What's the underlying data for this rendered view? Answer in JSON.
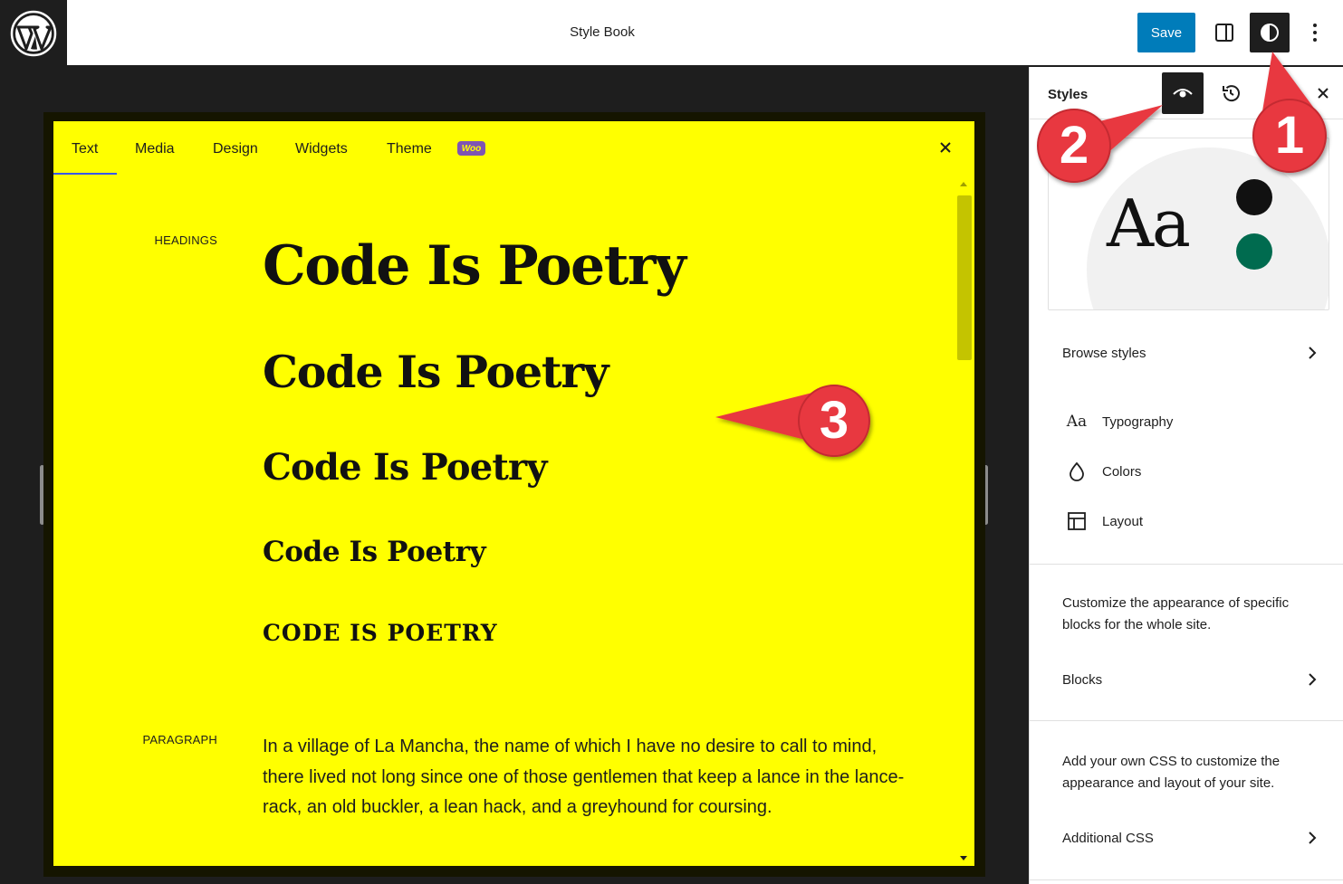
{
  "header": {
    "title": "Style Book",
    "save_label": "Save"
  },
  "stylebook": {
    "tabs": [
      {
        "label": "Text",
        "active": true
      },
      {
        "label": "Media",
        "active": false
      },
      {
        "label": "Design",
        "active": false
      },
      {
        "label": "Widgets",
        "active": false
      },
      {
        "label": "Theme",
        "active": false
      }
    ],
    "woo_badge": "Woo",
    "sections": {
      "headings_label": "HEADINGS",
      "paragraph_label": "PARAGRAPH"
    },
    "headings": {
      "h1": "Code Is Poetry",
      "h2": "Code Is Poetry",
      "h3": "Code Is Poetry",
      "h4": "Code Is Poetry",
      "h5": "CODE IS POETRY"
    },
    "paragraph": "In a village of La Mancha, the name of which I have no desire to call to mind, there lived not long since one of those gentlemen that keep a lance in the lance-rack, an old buckler, a lean hack, and a greyhound for coursing.",
    "background_color": "#ffff00"
  },
  "sidebar": {
    "title": "Styles",
    "preview": {
      "sample_text": "Aa",
      "colors": [
        "#111111",
        "#006b4f"
      ]
    },
    "browse_styles": "Browse styles",
    "nav": [
      {
        "label": "Typography",
        "icon": "typography-icon",
        "glyph": "Aa"
      },
      {
        "label": "Colors",
        "icon": "droplet-icon"
      },
      {
        "label": "Layout",
        "icon": "layout-icon"
      }
    ],
    "blocks_desc": "Customize the appearance of specific blocks for the whole site.",
    "blocks_label": "Blocks",
    "css_desc": "Add your own CSS to customize the appearance and layout of your site.",
    "css_label": "Additional CSS"
  },
  "callouts": [
    "1",
    "2",
    "3"
  ],
  "colors": {
    "accent": "#007cba",
    "dark": "#1e1e1e",
    "callout": "#e8393f"
  }
}
